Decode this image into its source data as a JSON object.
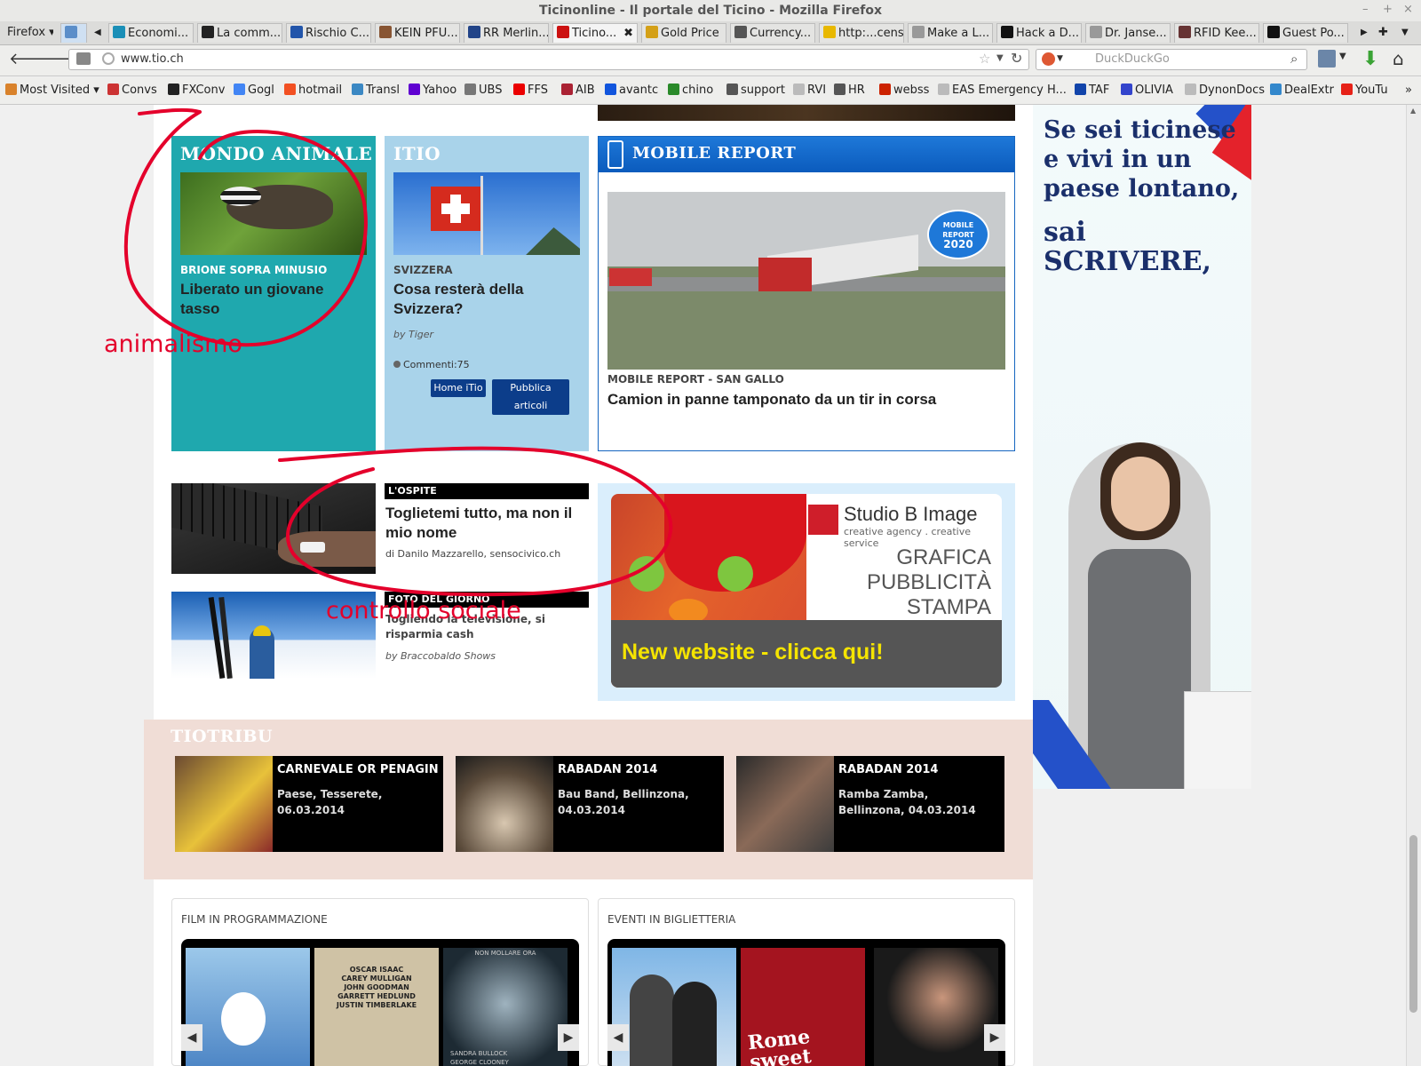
{
  "window": {
    "title": "Ticinonline - Il portale del Ticino - Mozilla Firefox",
    "controls": [
      "–",
      "+",
      "×"
    ]
  },
  "tabs": [
    {
      "label": "Firefox ▾",
      "fav": "#e66000"
    },
    {
      "label": "Economi...",
      "fav": "#1a8fb7"
    },
    {
      "label": "La comm...",
      "fav": "#222222"
    },
    {
      "label": "Rischio C...",
      "fav": "#2255aa"
    },
    {
      "label": "KEIN PFU...",
      "fav": "#885533"
    },
    {
      "label": "RR Merlin...",
      "fav": "#224488"
    },
    {
      "label": "Ticino...",
      "fav": "#cc1111",
      "active": true
    },
    {
      "label": "Gold Price",
      "fav": "#d4a017"
    },
    {
      "label": "Currency...",
      "fav": "#555555"
    },
    {
      "label": "http:...cens",
      "fav": "#e8b800"
    },
    {
      "label": "Make a L...",
      "fav": "#999999"
    },
    {
      "label": "Hack a D...",
      "fav": "#111111"
    },
    {
      "label": "Dr. Janse...",
      "fav": "#999999"
    },
    {
      "label": "RFID Kee...",
      "fav": "#663333"
    },
    {
      "label": "Guest Po...",
      "fav": "#111111"
    }
  ],
  "nav": {
    "url": "www.tio.ch",
    "search_placeholder": "DuckDuckGo"
  },
  "bookmarks": [
    {
      "label": "Most Visited ▾",
      "icon": "#d9822b"
    },
    {
      "label": "Convs",
      "icon": "#cc3333"
    },
    {
      "label": "FXConv",
      "icon": "#222222"
    },
    {
      "label": "Gogl",
      "icon": "#4285f4"
    },
    {
      "label": "hotmail",
      "icon": "#f25022"
    },
    {
      "label": "Transl",
      "icon": "#3b88c3"
    },
    {
      "label": "Yahoo",
      "icon": "#5f01d1"
    },
    {
      "label": "UBS",
      "icon": "#777777"
    },
    {
      "label": "FFS",
      "icon": "#eb0000"
    },
    {
      "label": "AIB",
      "icon": "#aa2233"
    },
    {
      "label": "avantc",
      "icon": "#1155dd"
    },
    {
      "label": "chino",
      "icon": "#2a8a2a"
    },
    {
      "label": "support",
      "icon": "#555555"
    },
    {
      "label": "RVI",
      "icon": "#bbbbbb"
    },
    {
      "label": "HR",
      "icon": "#555555"
    },
    {
      "label": "webss",
      "icon": "#cc2200"
    },
    {
      "label": "EAS Emergency H...",
      "icon": "#bbbbbb"
    },
    {
      "label": "TAF",
      "icon": "#1144aa"
    },
    {
      "label": "OLIVIA",
      "icon": "#3344cc"
    },
    {
      "label": "DynonDocs",
      "icon": "#bbbbbb"
    },
    {
      "label": "DealExtr",
      "icon": "#3388cc"
    },
    {
      "label": "YouTu",
      "icon": "#e62117"
    }
  ],
  "mondo_animale": {
    "header": "MONDO ANIMALE",
    "kicker": "BRIONE SOPRA MINUSIO",
    "headline": "Liberato un giovane tasso"
  },
  "itio": {
    "header": "ITIO",
    "kicker": "SVIZZERA",
    "headline": "Cosa resterà della Svizzera?",
    "byline": "by Tiger",
    "comments": "Commenti:75",
    "btn_home": "Home iTio",
    "btn_publish": "Pubblica articoli"
  },
  "mobile_report": {
    "header": "MOBILE REPORT",
    "badge": [
      "MOBILE",
      "REPORT",
      "2020"
    ],
    "kicker": "MOBILE REPORT - SAN GALLO",
    "headline": "Camion in panne tamponato da un tir in corsa"
  },
  "ospite": {
    "label": "L'OSPITE",
    "headline": "Toglietemi tutto, ma non il mio nome",
    "byline": "di Danilo Mazzarello, sensocivico.ch"
  },
  "foto": {
    "label": "FOTO DEL GIORNO",
    "headline": "Togliendo la televisione, si risparmia cash",
    "byline": "by Braccobaldo Shows"
  },
  "studio_ad": {
    "brand": "Studio B Image",
    "tagline": "creative agency . creative service",
    "lines": [
      "GRAFICA",
      "PUBBLICITÀ",
      "STAMPA"
    ],
    "cta": "New website - clicca qui!"
  },
  "side_ad": {
    "lines": [
      "Se sei ticinese",
      "e vivi in un",
      "paese lontano,",
      "sai SCRIVERE,"
    ]
  },
  "annotations": {
    "note1": "animalismo",
    "note2": "controllo sociale"
  },
  "tiotribu": {
    "header": "TIOTRIBU",
    "events": [
      {
        "title": "CARNEVALE OR PENAGIN",
        "detail": "Paese, Tesserete, 06.03.2014"
      },
      {
        "title": "RABADAN 2014",
        "detail": "Bau Band, Bellinzona, 04.03.2014"
      },
      {
        "title": "RABADAN 2014",
        "detail": "Ramba Zamba, Bellinzona, 04.03.2014"
      }
    ]
  },
  "films": {
    "title": "FILM IN PROGRAMMAZIONE",
    "poster_texts": [
      "OSCAR ISAAC",
      "CAREY MULLIGAN",
      "JOHN GOODMAN",
      "GARRETT HEDLUND",
      "JUSTIN TIMBERLAKE"
    ],
    "poster3_names": [
      "SANDRA BULLOCK",
      "GEORGE CLOONEY"
    ],
    "poster3_top": "NON MOLLARE ORA"
  },
  "eventi": {
    "title": "EVENTI IN BIGLIETTERIA",
    "show": "Rome sweet home"
  }
}
